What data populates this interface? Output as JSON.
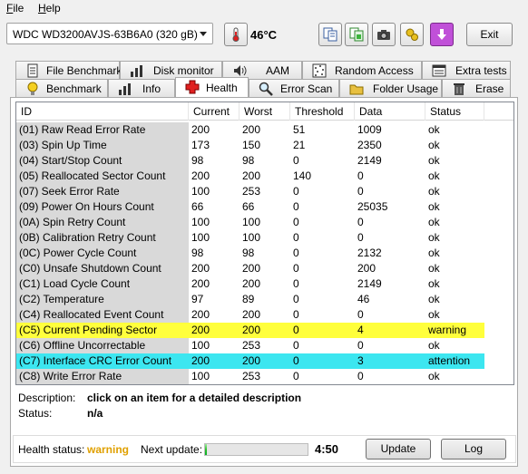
{
  "menu": {
    "file": "File",
    "help": "Help"
  },
  "toolbar": {
    "drive": "WDC WD3200AVJS-63B6A0 (320 gB)",
    "temperature": "46°C",
    "exit_label": "Exit"
  },
  "tabs_top": [
    {
      "label": "File Benchmark",
      "icon": "file-benchmark-icon"
    },
    {
      "label": "Disk monitor",
      "icon": "disk-monitor-icon"
    },
    {
      "label": "AAM",
      "icon": "speaker-icon"
    },
    {
      "label": "Random Access",
      "icon": "random-access-icon"
    },
    {
      "label": "Extra tests",
      "icon": "extra-tests-icon"
    }
  ],
  "tabs_bottom": [
    {
      "label": "Benchmark",
      "icon": "lightbulb-icon"
    },
    {
      "label": "Info",
      "icon": "info-icon"
    },
    {
      "label": "Health",
      "icon": "red-cross-icon"
    },
    {
      "label": "Error Scan",
      "icon": "magnifier-icon"
    },
    {
      "label": "Folder Usage",
      "icon": "folder-icon"
    },
    {
      "label": "Erase",
      "icon": "trash-icon"
    }
  ],
  "table": {
    "columns": [
      "ID",
      "Current",
      "Worst",
      "Threshold",
      "Data",
      "Status"
    ],
    "rows": [
      {
        "id": "(01) Raw Read Error Rate",
        "current": "200",
        "worst": "200",
        "threshold": "51",
        "data": "1009",
        "status": "ok",
        "level": "ok"
      },
      {
        "id": "(03) Spin Up Time",
        "current": "173",
        "worst": "150",
        "threshold": "21",
        "data": "2350",
        "status": "ok",
        "level": "ok"
      },
      {
        "id": "(04) Start/Stop Count",
        "current": "98",
        "worst": "98",
        "threshold": "0",
        "data": "2149",
        "status": "ok",
        "level": "ok"
      },
      {
        "id": "(05) Reallocated Sector Count",
        "current": "200",
        "worst": "200",
        "threshold": "140",
        "data": "0",
        "status": "ok",
        "level": "ok"
      },
      {
        "id": "(07) Seek Error Rate",
        "current": "100",
        "worst": "253",
        "threshold": "0",
        "data": "0",
        "status": "ok",
        "level": "ok"
      },
      {
        "id": "(09) Power On Hours Count",
        "current": "66",
        "worst": "66",
        "threshold": "0",
        "data": "25035",
        "status": "ok",
        "level": "ok"
      },
      {
        "id": "(0A) Spin Retry Count",
        "current": "100",
        "worst": "100",
        "threshold": "0",
        "data": "0",
        "status": "ok",
        "level": "ok"
      },
      {
        "id": "(0B) Calibration Retry Count",
        "current": "100",
        "worst": "100",
        "threshold": "0",
        "data": "0",
        "status": "ok",
        "level": "ok"
      },
      {
        "id": "(0C) Power Cycle Count",
        "current": "98",
        "worst": "98",
        "threshold": "0",
        "data": "2132",
        "status": "ok",
        "level": "ok"
      },
      {
        "id": "(C0) Unsafe Shutdown Count",
        "current": "200",
        "worst": "200",
        "threshold": "0",
        "data": "200",
        "status": "ok",
        "level": "ok"
      },
      {
        "id": "(C1) Load Cycle Count",
        "current": "200",
        "worst": "200",
        "threshold": "0",
        "data": "2149",
        "status": "ok",
        "level": "ok"
      },
      {
        "id": "(C2) Temperature",
        "current": "97",
        "worst": "89",
        "threshold": "0",
        "data": "46",
        "status": "ok",
        "level": "ok"
      },
      {
        "id": "(C4) Reallocated Event Count",
        "current": "200",
        "worst": "200",
        "threshold": "0",
        "data": "0",
        "status": "ok",
        "level": "ok"
      },
      {
        "id": "(C5) Current Pending Sector",
        "current": "200",
        "worst": "200",
        "threshold": "0",
        "data": "4",
        "status": "warning",
        "level": "warning"
      },
      {
        "id": "(C6) Offline Uncorrectable",
        "current": "100",
        "worst": "253",
        "threshold": "0",
        "data": "0",
        "status": "ok",
        "level": "ok"
      },
      {
        "id": "(C7) Interface CRC Error Count",
        "current": "200",
        "worst": "200",
        "threshold": "0",
        "data": "3",
        "status": "attention",
        "level": "attention"
      },
      {
        "id": "(C8) Write Error Rate",
        "current": "100",
        "worst": "253",
        "threshold": "0",
        "data": "0",
        "status": "ok",
        "level": "ok"
      }
    ]
  },
  "description": {
    "label": "Description:",
    "value": "click on an item for a detailed description",
    "status_label": "Status:",
    "status_value": "n/a"
  },
  "footer": {
    "health_label": "Health status:",
    "health_value": "warning",
    "next_update_label": "Next update:",
    "next_update_progress": 0.02,
    "time": "4:50",
    "update_label": "Update",
    "log_label": "Log"
  },
  "colors": {
    "warning_row": "#ffff3c",
    "attention_row": "#3ce6f0",
    "health_warning_text": "#e0a000"
  }
}
